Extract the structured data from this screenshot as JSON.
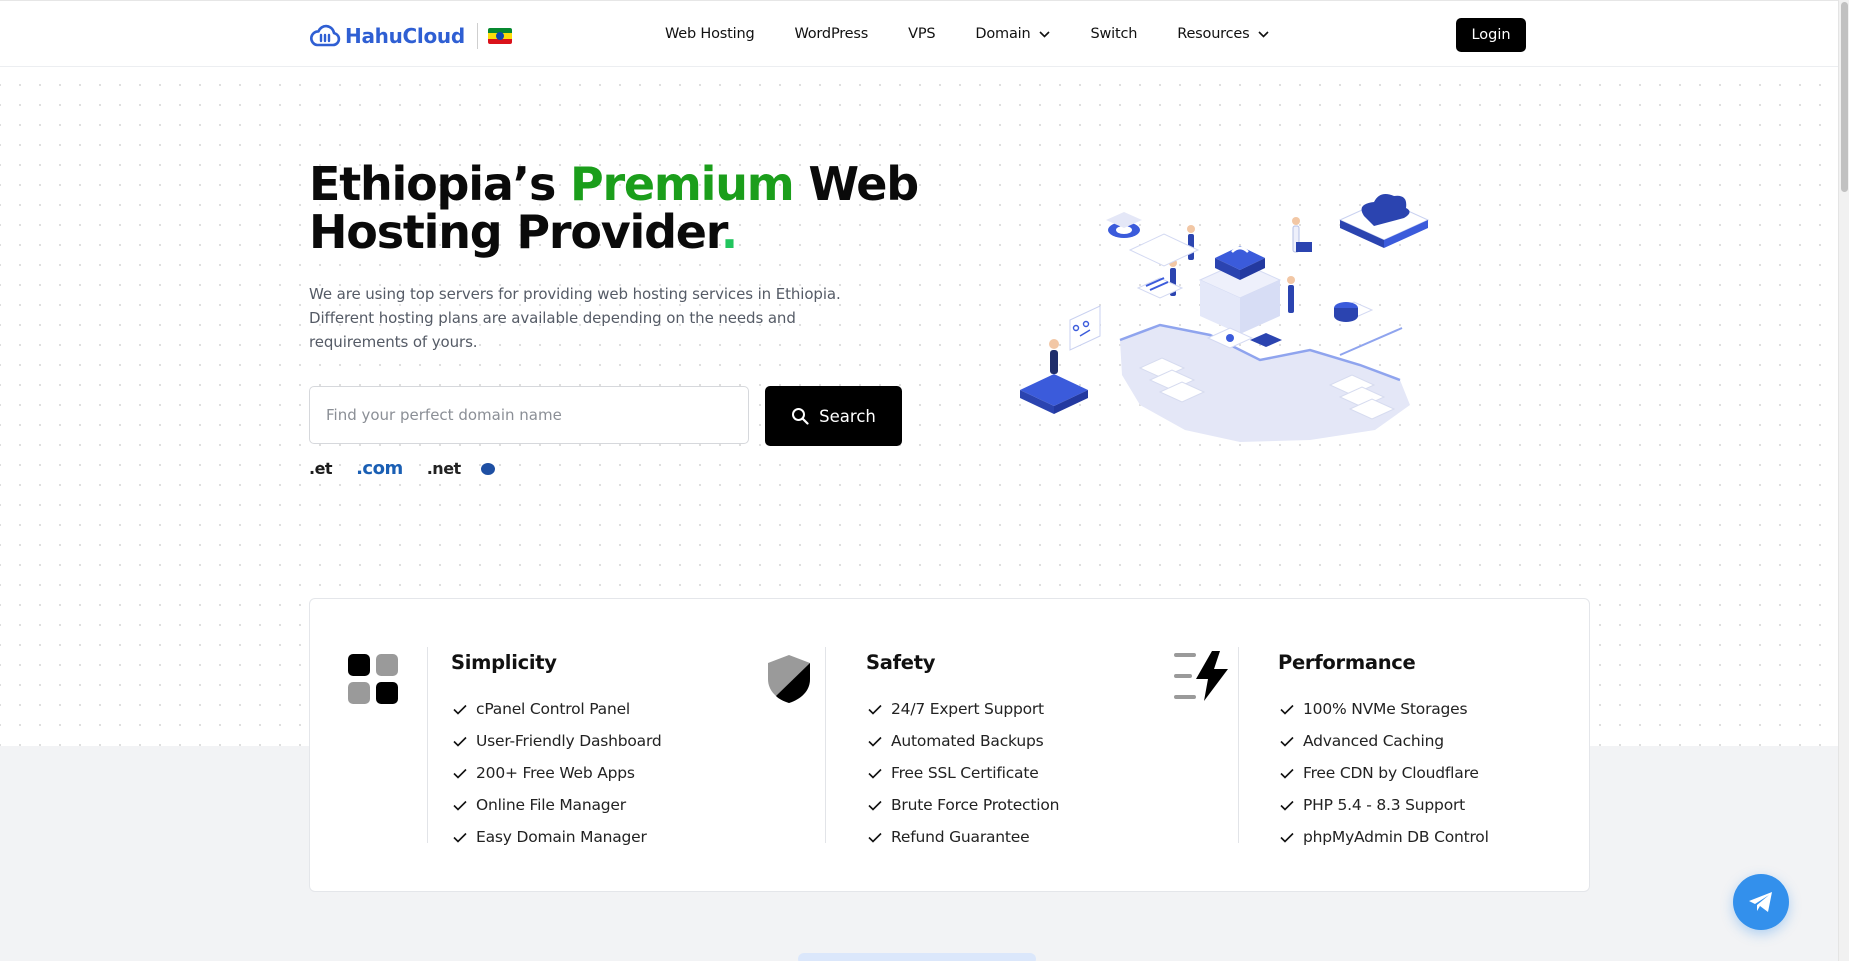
{
  "header": {
    "logo_text": "HahuCloud",
    "nav": [
      {
        "label": "Web Hosting",
        "dropdown": false
      },
      {
        "label": "WordPress",
        "dropdown": false
      },
      {
        "label": "VPS",
        "dropdown": false
      },
      {
        "label": "Domain",
        "dropdown": true
      },
      {
        "label": "Switch",
        "dropdown": false
      },
      {
        "label": "Resources",
        "dropdown": true
      }
    ],
    "login_label": "Login"
  },
  "hero": {
    "title_part1": "Ethiopia’s ",
    "title_highlight": "Premium",
    "title_part2": " Web Hosting Provider",
    "title_dot": ".",
    "description": "We are using top servers for providing web hosting services in Ethiopia. Different hosting plans are available depending on the needs and requirements of yours.",
    "search_placeholder": "Find your perfect domain name",
    "search_button": "Search",
    "tlds": [
      ".et",
      ".com",
      ".net"
    ]
  },
  "features": [
    {
      "title": "Simplicity",
      "icon": "grid-squares-icon",
      "items": [
        "cPanel Control Panel",
        "User-Friendly Dashboard",
        "200+ Free Web Apps",
        "Online File Manager",
        "Easy Domain Manager"
      ]
    },
    {
      "title": "Safety",
      "icon": "shield-icon",
      "items": [
        "24/7 Expert Support",
        "Automated Backups",
        "Free SSL Certificate",
        "Brute Force Protection",
        "Refund Guarantee"
      ]
    },
    {
      "title": "Performance",
      "icon": "lightning-icon",
      "items": [
        "100% NVMe Storages",
        "Advanced Caching",
        "Free CDN by Cloudflare",
        "PHP 5.4 - 8.3 Support",
        "phpMyAdmin DB Control"
      ]
    }
  ],
  "colors": {
    "brand_blue": "#2f5fd3",
    "highlight_green": "#1b9e1b",
    "telegram_blue": "#3390ec"
  }
}
